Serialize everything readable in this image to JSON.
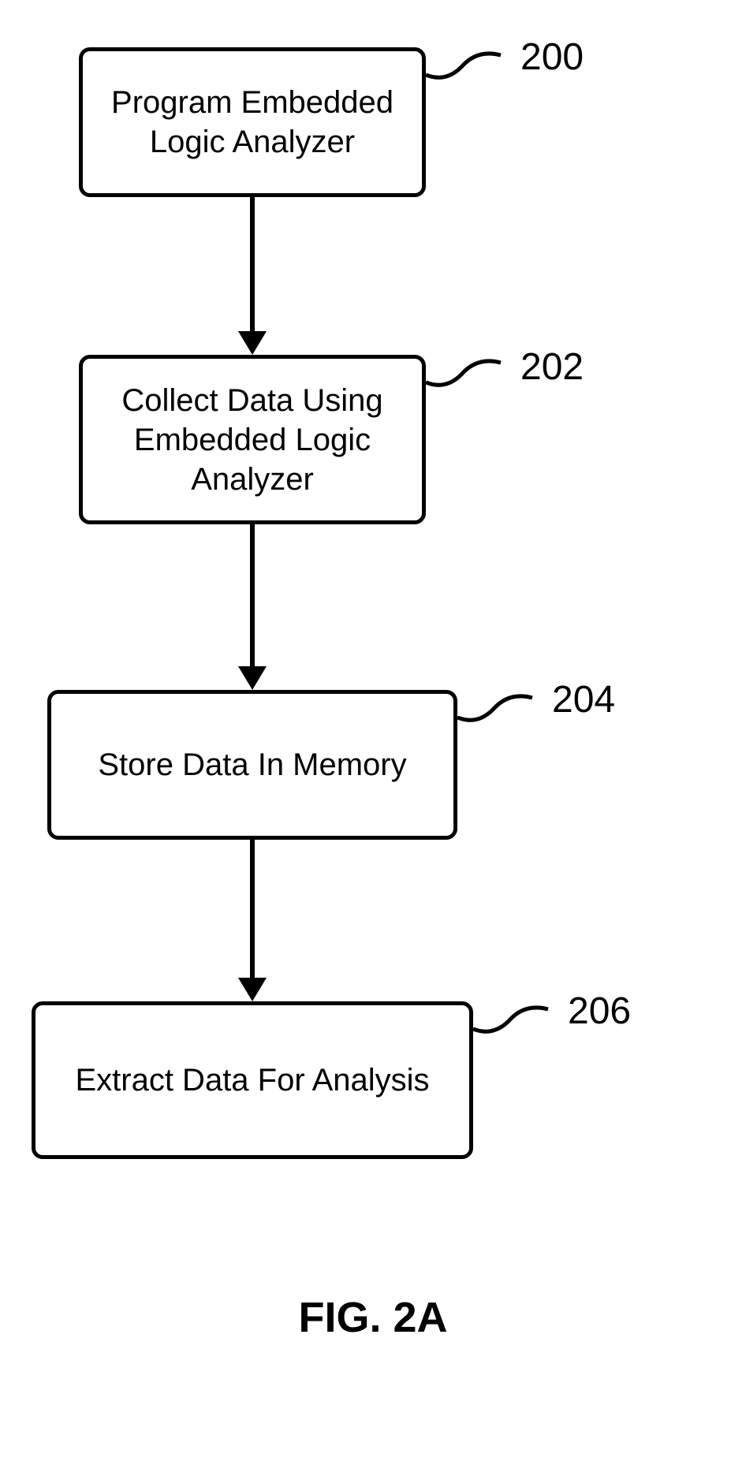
{
  "boxes": {
    "b200": {
      "text": "Program Embedded\nLogic Analyzer",
      "ref": "200"
    },
    "b202": {
      "text": "Collect Data Using\nEmbedded Logic\nAnalyzer",
      "ref": "202"
    },
    "b204": {
      "text": "Store Data In Memory",
      "ref": "204"
    },
    "b206": {
      "text": "Extract Data For Analysis",
      "ref": "206"
    }
  },
  "caption": "FIG. 2A"
}
